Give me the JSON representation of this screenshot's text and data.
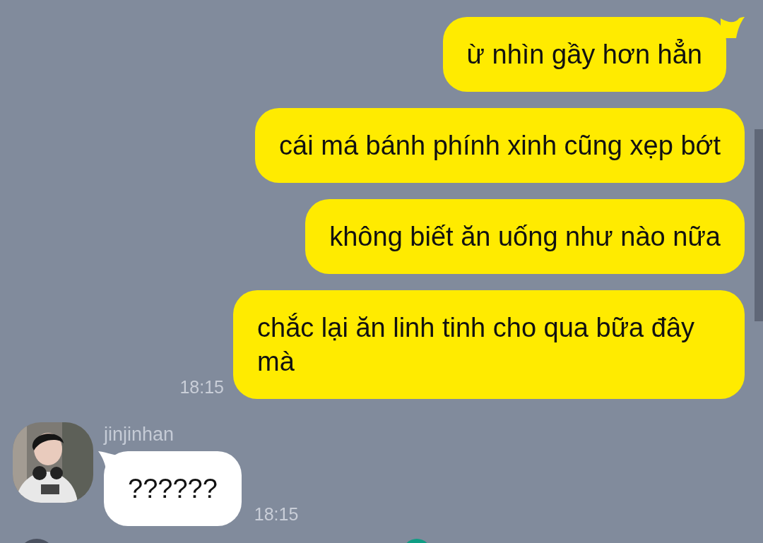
{
  "messages": [
    {
      "kind": "out",
      "text": "ừ nhìn gầy hơn hẳn",
      "tail": true
    },
    {
      "kind": "out",
      "text": "cái má bánh phính xinh cũng xẹp bớt",
      "tail": false
    },
    {
      "kind": "out",
      "text": "không biết ăn uống như nào nữa",
      "tail": false
    },
    {
      "kind": "out",
      "text": "chắc lại ăn linh tinh cho qua bữa đây mà",
      "tail": false,
      "time": "18:15"
    },
    {
      "kind": "in",
      "sender": "jinjinhan",
      "text": "??????",
      "tail": true,
      "time": "18:15"
    }
  ]
}
